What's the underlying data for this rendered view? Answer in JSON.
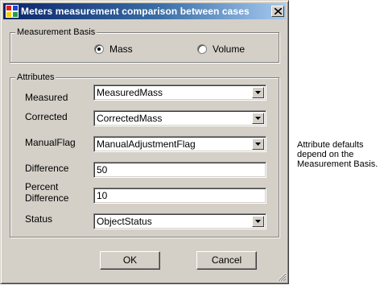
{
  "window": {
    "title": "Meters measurement comparison between cases",
    "icon": "app-grid-icon",
    "close_icon": "close-icon"
  },
  "measurement_basis": {
    "label": "Measurement Basis",
    "options": [
      {
        "label": "Mass",
        "selected": true
      },
      {
        "label": "Volume",
        "selected": false
      }
    ]
  },
  "attributes": {
    "label": "Attributes",
    "measured": {
      "label": "Measured",
      "value": "MeasuredMass"
    },
    "corrected": {
      "label": "Corrected",
      "value": "CorrectedMass"
    },
    "manual_flag": {
      "label": "ManualFlag",
      "value": "ManualAdjustmentFlag"
    },
    "difference": {
      "label": "Difference",
      "value": "50"
    },
    "percent_difference": {
      "label": "Percent\nDifference",
      "value": "10"
    },
    "status": {
      "label": "Status",
      "value": "ObjectStatus"
    }
  },
  "buttons": {
    "ok": "OK",
    "cancel": "Cancel"
  },
  "side_note": "Attribute defaults\ndepend on the\nMeasurement Basis.",
  "colors": {
    "title_bar_start": "#0a246a",
    "title_bar_end": "#a6caf0",
    "dialog_face": "#d4d0c8"
  }
}
